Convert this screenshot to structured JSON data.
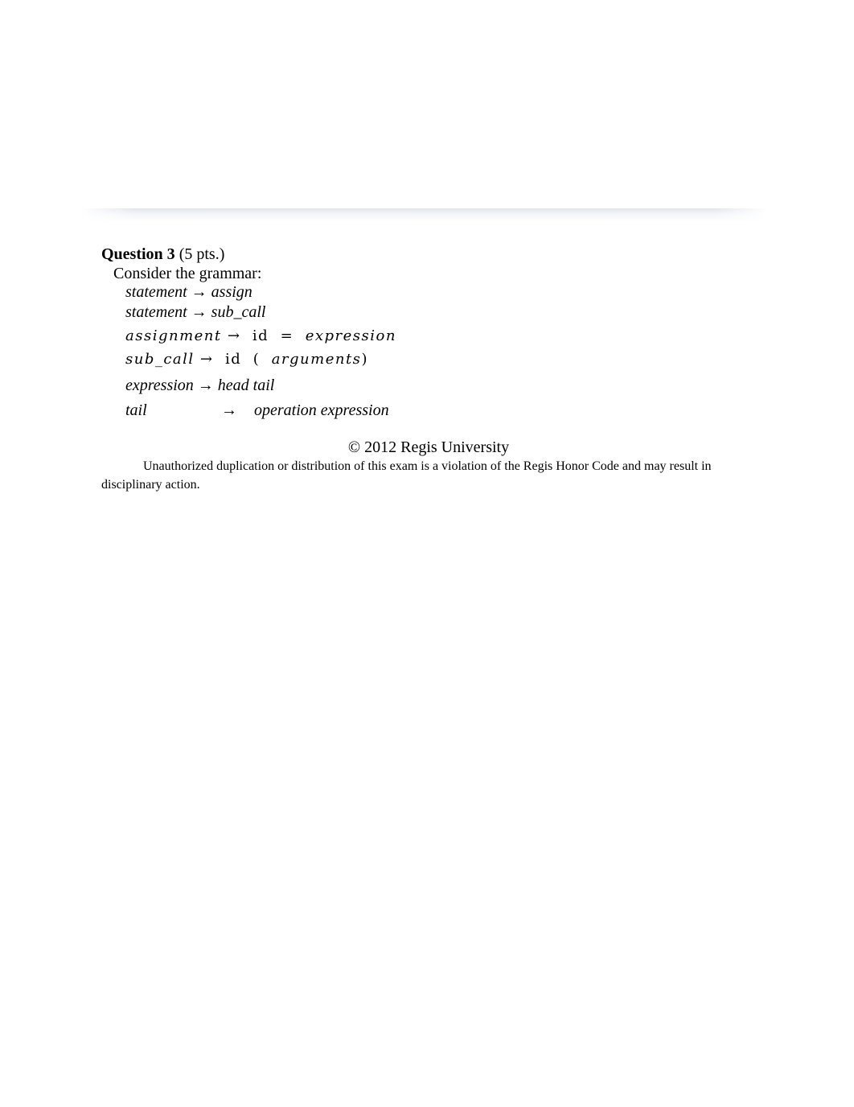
{
  "question": {
    "title": "Question 3",
    "points": "(5 pts.)",
    "intro": "Consider the grammar:"
  },
  "grammar": {
    "arrow": "→",
    "rules": [
      {
        "lhs": "statement",
        "rhs": [
          "assign"
        ]
      },
      {
        "lhs": "statement",
        "rhs": [
          "sub_call"
        ]
      },
      {
        "lhs": "assignment",
        "rhs": [
          "id",
          "=",
          "expression"
        ]
      },
      {
        "lhs": "sub_call",
        "rhs": [
          "id",
          "(",
          "arguments",
          ")"
        ]
      },
      {
        "lhs": "expression",
        "rhs": [
          "head tail"
        ]
      },
      {
        "lhs": "tail",
        "rhs": [
          "operation expression"
        ]
      }
    ]
  },
  "footer": {
    "copyright": "© 2012 Regis University",
    "notice": "Unauthorized duplication or distribution of this exam is a violation of the Regis Honor Code and may result in disciplinary action."
  }
}
